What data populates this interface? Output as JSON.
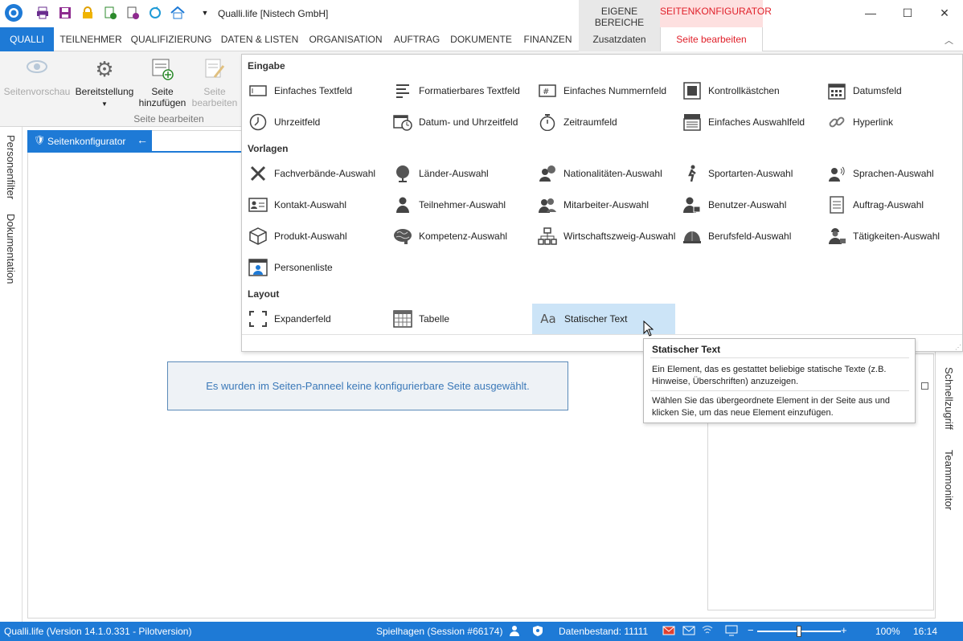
{
  "window": {
    "title": "Qualli.life [Nistech GmbH]",
    "context_groups": {
      "eigene": "EIGENE BEREICHE",
      "seitenkonf": "SEITENKONFIGURATOR"
    }
  },
  "tabs": [
    "QUALLI",
    "TEILNEHMER",
    "QUALIFIZIERUNG",
    "DATEN & LISTEN",
    "ORGANISATION",
    "AUFTRAG",
    "DOKUMENTE",
    "FINANZEN"
  ],
  "context_tabs": {
    "zusatzdaten": "Zusatzdaten",
    "seite_bearbeiten": "Seite bearbeiten"
  },
  "ribbon": {
    "seitenvorschau": "Seitenvorschau",
    "bereitstellung": "Bereitstellung",
    "seite_hinzufuegen_1": "Seite",
    "seite_hinzufuegen_2": "hinzufügen",
    "seite_bearbeiten_1": "Seite",
    "seite_bearbeiten_2": "bearbeiten",
    "group_label": "Seite bearbeiten"
  },
  "left_panel": {
    "side_tabs": [
      "Personenfilter",
      "Dokumentation"
    ],
    "header": "Seitenkonfigurator",
    "empty_message": "Es wurden im Seiten-Panneel keine konfigurierbare Seite ausgewählt."
  },
  "gallery": {
    "eingabe": {
      "title": "Eingabe",
      "items": [
        {
          "label": "Einfaches Textfeld",
          "icon": "textbox-icon"
        },
        {
          "label": "Formatierbares Textfeld",
          "icon": "richtext-icon"
        },
        {
          "label": "Einfaches Nummernfeld",
          "icon": "number-field-icon"
        },
        {
          "label": "Kontrollkästchen",
          "icon": "checkbox-icon"
        },
        {
          "label": "Datumsfeld",
          "icon": "calendar-icon"
        },
        {
          "label": "Uhrzeitfeld",
          "icon": "clock-icon"
        },
        {
          "label": "Datum- und Uhrzeitfeld",
          "icon": "calendar-clock-icon"
        },
        {
          "label": "Zeitraumfeld",
          "icon": "stopwatch-icon"
        },
        {
          "label": "Einfaches Auswahlfeld",
          "icon": "dropdown-icon"
        },
        {
          "label": "Hyperlink",
          "icon": "link-icon"
        }
      ]
    },
    "vorlagen": {
      "title": "Vorlagen",
      "items": [
        {
          "label": "Fachverbände-Auswahl",
          "icon": "tools-icon"
        },
        {
          "label": "Länder-Auswahl",
          "icon": "globe-icon"
        },
        {
          "label": "Nationalitäten-Auswahl",
          "icon": "nationality-icon"
        },
        {
          "label": "Sportarten-Auswahl",
          "icon": "sport-icon"
        },
        {
          "label": "Sprachen-Auswahl",
          "icon": "speaking-icon"
        },
        {
          "label": "Kontakt-Auswahl",
          "icon": "contact-card-icon"
        },
        {
          "label": "Teilnehmer-Auswahl",
          "icon": "person-icon"
        },
        {
          "label": "Mitarbeiter-Auswahl",
          "icon": "people-icon"
        },
        {
          "label": "Benutzer-Auswahl",
          "icon": "user-lock-icon"
        },
        {
          "label": "Auftrag-Auswahl",
          "icon": "document-icon"
        },
        {
          "label": "Produkt-Auswahl",
          "icon": "cube-icon"
        },
        {
          "label": "Kompetenz-Auswahl",
          "icon": "brain-icon"
        },
        {
          "label": "Wirtschaftszweig-Auswahl",
          "icon": "hierarchy-icon"
        },
        {
          "label": "Berufsfeld-Auswahl",
          "icon": "helmet-icon"
        },
        {
          "label": "Tätigkeiten-Auswahl",
          "icon": "worker-icon"
        },
        {
          "label": "Personenliste",
          "icon": "person-list-icon"
        }
      ]
    },
    "layout": {
      "title": "Layout",
      "items": [
        {
          "label": "Expanderfeld",
          "icon": "expander-icon"
        },
        {
          "label": "Tabelle",
          "icon": "table-icon"
        },
        {
          "label": "Statischer Text",
          "icon": "static-text-icon",
          "selected": true
        }
      ]
    }
  },
  "tooltip": {
    "title": "Statischer Text",
    "body": "Ein Element, das es gestattet beliebige statische Texte (z.B. Hinweise, Überschriften) anzuzeigen.",
    "hint": "Wählen Sie das übergeordnete Element in der Seite aus und klicken Sie, um das neue Element einzufügen."
  },
  "right_side_tabs": [
    "Schnellzugriff",
    "Teammonitor"
  ],
  "status": {
    "version": "Qualli.life (Version 14.1.0.331 - Pilotversion)",
    "session": "Spielhagen (Session #66174)",
    "datenbestand": "Datenbestand: 11111",
    "zoom": "100%",
    "time": "16:14",
    "zoom_level": 0.5
  },
  "colors": {
    "accent": "#1e7ad6",
    "context_red": "#e0202a",
    "context_tab_bg": "#fde0e0",
    "selected_bg": "#cce4f7"
  }
}
